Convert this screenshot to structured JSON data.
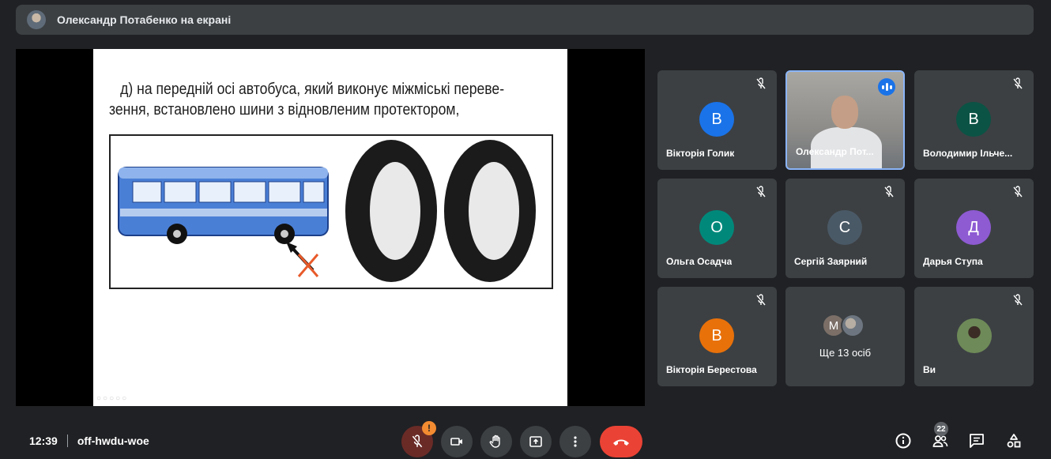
{
  "topbar": {
    "title": "Олександр Потабенко на екрані"
  },
  "slide": {
    "line1": "д) на передній осі автобуса, який виконує міжміські переве-",
    "line2": "зення, встановлено шини з відновленим протектором,"
  },
  "participants": [
    {
      "name": "Вікторія Голик",
      "initial": "В",
      "color": "#1a73e8",
      "muted": true
    },
    {
      "name": "Олександр Пот...",
      "video": true,
      "speaking": true
    },
    {
      "name": "Володимир Ільче...",
      "initial": "В",
      "color": "#0b5345",
      "muted": true
    },
    {
      "name": "Ольга Осадча",
      "initial": "О",
      "color": "#00897b",
      "muted": true
    },
    {
      "name": "Сергій Заярний",
      "initial": "С",
      "color": "#4a5966",
      "muted": true
    },
    {
      "name": "Дарья Ступа",
      "initial": "Д",
      "color": "#8e5bd3",
      "muted": true
    },
    {
      "name": "Вікторія Берестова",
      "initial": "В",
      "color": "#e8710a",
      "muted": true
    },
    {
      "more_label": "Ще 13 осіб",
      "initial": "М"
    },
    {
      "name": "Ви",
      "muted": true
    }
  ],
  "footer": {
    "time": "12:39",
    "meeting_code": "off-hwdu-woe",
    "mic_badge": "!",
    "people_count": "22"
  },
  "colors": {
    "hangup": "#ea4335",
    "accent": "#1a73e8",
    "speaker_border": "#8ab4f8"
  }
}
